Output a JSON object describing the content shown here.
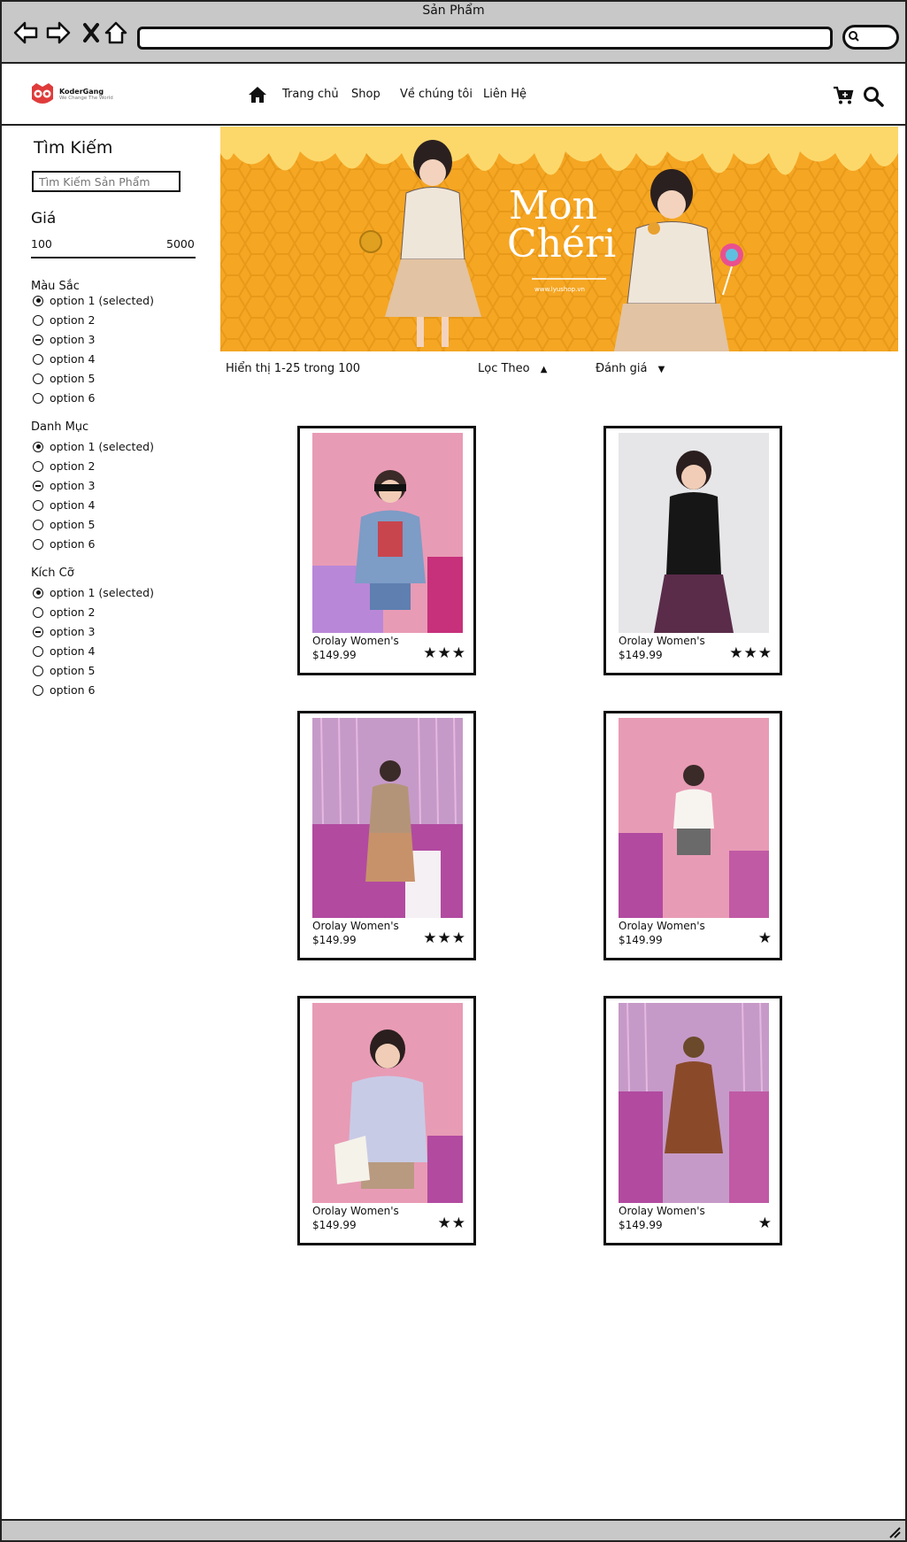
{
  "window": {
    "title": "Sản Phẩm"
  },
  "nav": {
    "brand_name": "KoderGang",
    "brand_tagline": "We Change The World",
    "links": [
      "Trang chủ",
      "Shop",
      "Về chúng tôi",
      "Liên Hệ"
    ]
  },
  "sidebar": {
    "search_title": "Tìm Kiếm",
    "search_placeholder": "Tìm Kiếm Sản Phẩm",
    "price_title": "Giá",
    "price_min": "100",
    "price_max": "5000",
    "groups": [
      {
        "title": "Màu Sắc",
        "options": [
          "option 1 (selected)",
          "option 2",
          "option 3",
          "option 4",
          "option 5",
          "option 6"
        ]
      },
      {
        "title": "Danh Mục",
        "options": [
          "option 1 (selected)",
          "option 2",
          "option 3",
          "option 4",
          "option 5",
          "option 6"
        ]
      },
      {
        "title": "Kích Cỡ",
        "options": [
          "option 1 (selected)",
          "option 2",
          "option 3",
          "option 4",
          "option 5",
          "option 6"
        ]
      }
    ]
  },
  "banner": {
    "title_line1": "Mon",
    "title_line2": "Chéri",
    "url": "www.lyushop.vn"
  },
  "toolbar": {
    "showing": "Hiển thị 1-25 trong 100",
    "filter_label": "Lọc Theo",
    "rating_label": "Đánh giá"
  },
  "products": [
    {
      "name": "Orolay Women's",
      "price": "$149.99",
      "rating": 3
    },
    {
      "name": "Orolay Women's",
      "price": "$149.99",
      "rating": 3
    },
    {
      "name": "Orolay Women's",
      "price": "$149.99",
      "rating": 3
    },
    {
      "name": "Orolay Women's",
      "price": "$149.99",
      "rating": 1
    },
    {
      "name": "Orolay Women's",
      "price": "$149.99",
      "rating": 2
    },
    {
      "name": "Orolay Women's",
      "price": "$149.99",
      "rating": 1
    }
  ],
  "colors": {
    "banner_bg": "#f5a623",
    "photo_pink": "#e89bb5",
    "photo_magenta": "#b95aa6",
    "chrome_gray": "#c8c8c8"
  },
  "icons": [
    "back-icon",
    "forward-icon",
    "close-icon",
    "home-icon",
    "cart-icon",
    "search-icon"
  ]
}
